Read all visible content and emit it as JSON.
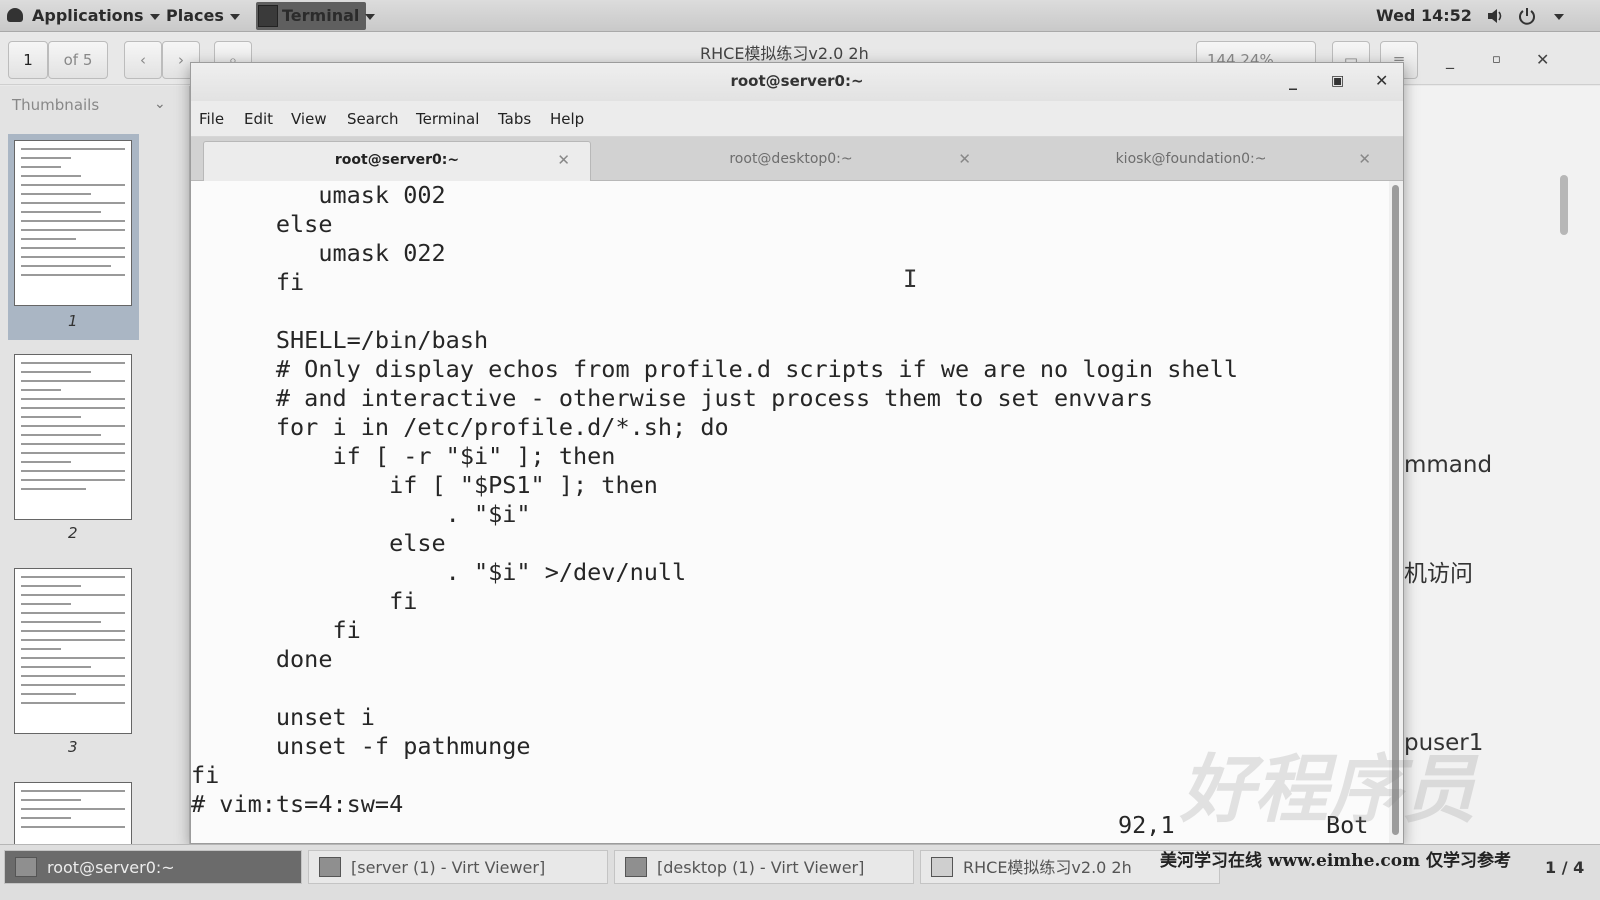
{
  "topbar": {
    "applications": "Applications",
    "places": "Places",
    "terminal": "Terminal",
    "clock": "Wed 14:52"
  },
  "viewer": {
    "page_number": "1",
    "page_of": "of 5",
    "title": "RHCE模拟练习v2.0 2h",
    "zoom": "144.24%",
    "sidebar_label": "Thumbnails",
    "thumb_numbers": [
      "1",
      "2",
      "3"
    ],
    "doc_fragments": [
      "mmand",
      "机访问",
      "puser1"
    ]
  },
  "terminal": {
    "title": "root@server0:~",
    "menu": [
      "File",
      "Edit",
      "View",
      "Search",
      "Terminal",
      "Tabs",
      "Help"
    ],
    "tabs": [
      {
        "label": "root@server0:~",
        "active": true
      },
      {
        "label": "root@desktop0:~",
        "active": false
      },
      {
        "label": "kiosk@foundation0:~",
        "active": false
      }
    ],
    "lines": [
      "         umask 002",
      "      else",
      "         umask 022",
      "      fi",
      "",
      "      SHELL=/bin/bash",
      "      # Only display echos from profile.d scripts if we are no login shell",
      "      # and interactive - otherwise just process them to set envvars",
      "      for i in /etc/profile.d/*.sh; do",
      "          if [ -r \"$i\" ]; then",
      "              if [ \"$PS1\" ]; then",
      "                  . \"$i\"",
      "              else",
      "                  . \"$i\" >/dev/null",
      "              fi",
      "          fi",
      "      done",
      "",
      "      unset i",
      "      unset -f pathmunge",
      "fi",
      "# vim:ts=4:sw=4"
    ],
    "status_position": "92,1",
    "status_scroll": "Bot"
  },
  "taskbar": {
    "items": [
      {
        "label": "root@server0:~",
        "current": true
      },
      {
        "label": "[server (1) - Virt Viewer]",
        "current": false
      },
      {
        "label": "[desktop (1) - Virt Viewer]",
        "current": false
      },
      {
        "label": "RHCE模拟练习v2.0 2h",
        "current": false
      }
    ],
    "watermark": "好程序员",
    "footer_note": "美河学习在线 www.eimhe.com 仅学习参考",
    "page_counter": "1 / 4"
  }
}
